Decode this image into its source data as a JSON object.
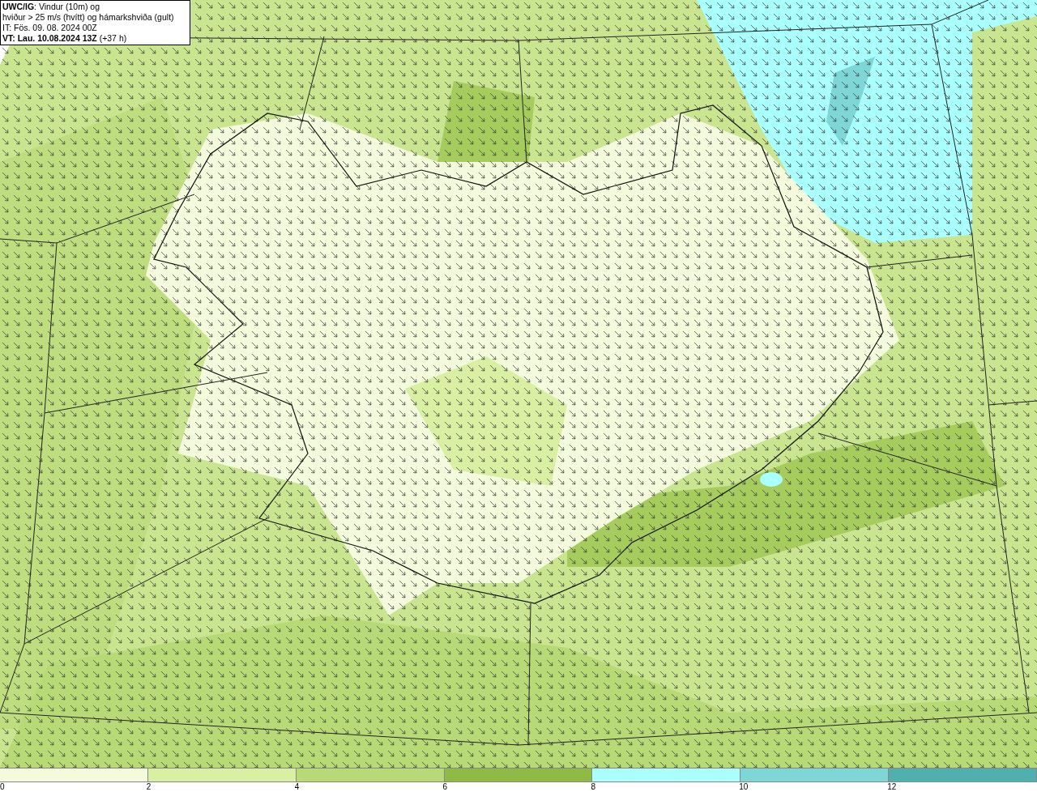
{
  "title_box": {
    "lines": [
      "**UWC/IG**: Vindur (10m) og",
      "hviður > 25 m/s (hvítt) og hámarkshviða (gult)",
      "IT: Fös. 09. 08. 2024 00Z",
      "**VT: Lau. 10.08.2024 13Z** (+37 h)"
    ]
  },
  "legend": {
    "segments": [
      {
        "color": "#f4fbdc"
      },
      {
        "color": "#d9f0a3"
      },
      {
        "color": "#b8da76"
      },
      {
        "color": "#8fbb45"
      },
      {
        "color": "#aaffff"
      },
      {
        "color": "#7fd6d6"
      },
      {
        "color": "#50b0b0"
      }
    ],
    "labels": [
      "0",
      "2",
      "4",
      "6",
      "8",
      "10",
      "12"
    ]
  }
}
